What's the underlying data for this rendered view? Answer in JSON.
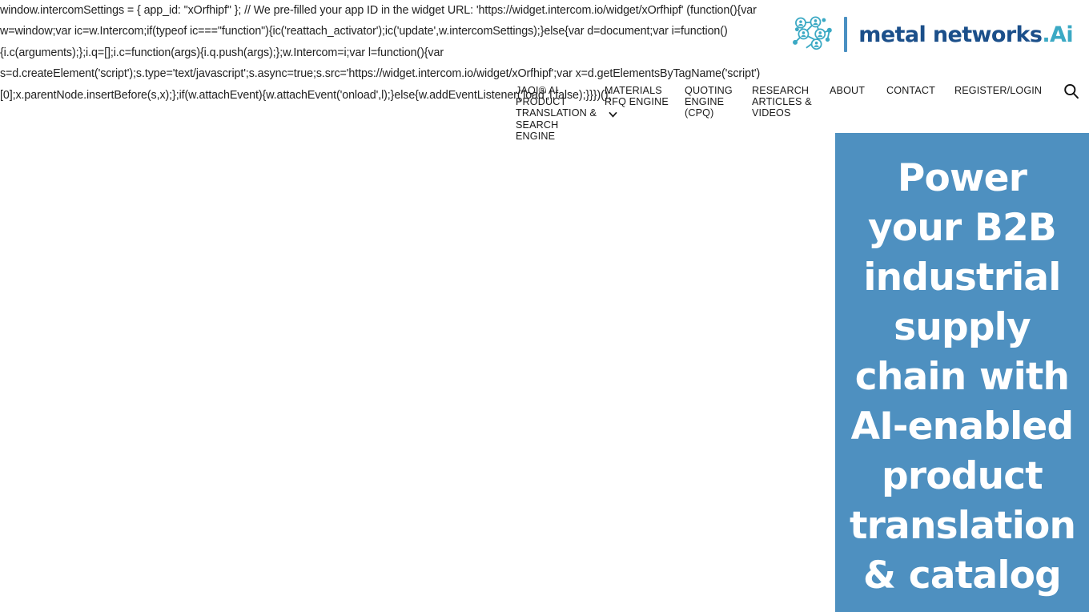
{
  "script_leak": {
    "lines": [
      "window.intercomSettings = { app_id: \"xOrfhipf\" }; // We pre-filled your app ID in the widget URL: 'https://widget.intercom.io/widget/xOrfhipf' (function(){var",
      "w=window;var ic=w.Intercom;if(typeof ic===\"function\"){ic('reattach_activator');ic('update',w.intercomSettings);}else{var d=document;var i=function()",
      "{i.c(arguments);};i.q=[];i.c=function(args){i.q.push(args);};w.Intercom=i;var l=function(){var",
      "s=d.createElement('script');s.type='text/javascript';s.async=true;s.src='https://widget.intercom.io/widget/xOrfhipf';var x=d.getElementsByTagName('script')",
      "[0];x.parentNode.insertBefore(s,x);};if(w.attachEvent){w.attachEvent('onload',l);}else{w.addEventListener('load',l,false);}}})();"
    ]
  },
  "header": {
    "logo": {
      "mark_icon": "network-nodes-icon",
      "wordmark_primary": "metal networks",
      "wordmark_accent": ".Ai",
      "color_primary": "#1b4f8a",
      "color_accent": "#3ba9c4",
      "divider_color": "#4a90c2"
    },
    "nav": {
      "items": [
        {
          "id": "jaqi",
          "label": "JAQI® AI PRODUCT TRANSLATION & SEARCH ENGINE",
          "has_dropdown": false
        },
        {
          "id": "materials",
          "label": "MATERIALS RFQ ENGINE",
          "has_dropdown": true
        },
        {
          "id": "quoting",
          "label": "QUOTING ENGINE (CPQ)",
          "has_dropdown": false
        },
        {
          "id": "research",
          "label": "RESEARCH ARTICLES & VIDEOS",
          "has_dropdown": false
        },
        {
          "id": "about",
          "label": "ABOUT",
          "has_dropdown": false
        },
        {
          "id": "contact",
          "label": "CONTACT",
          "has_dropdown": false
        },
        {
          "id": "register",
          "label": "REGISTER/LOGIN",
          "has_dropdown": false
        }
      ],
      "search_icon": "magnifier-icon",
      "chevron_icon": "chevron-down-icon"
    }
  },
  "hero": {
    "background_color": "#4e90c0",
    "headline": "Power your B2B industrial supply chain with AI-enabled product translation & catalog"
  }
}
